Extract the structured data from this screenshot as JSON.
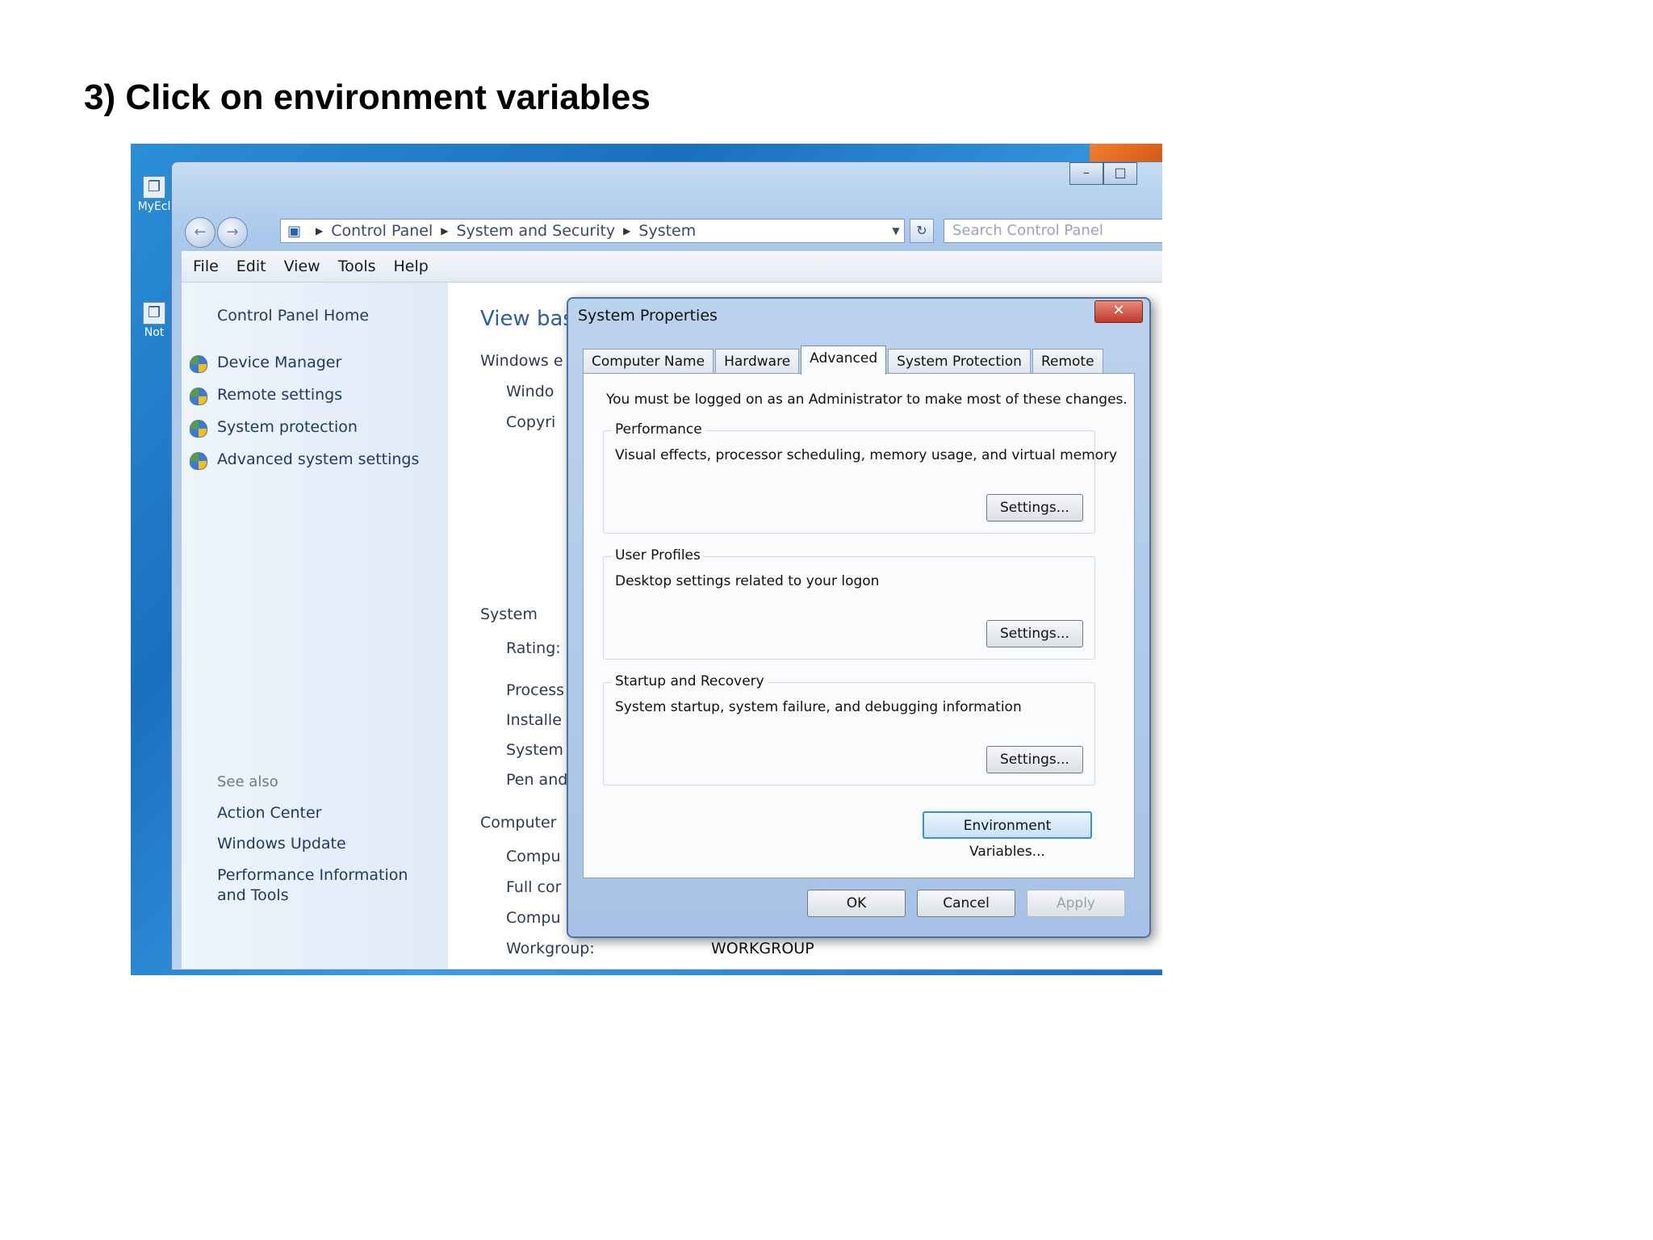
{
  "heading": "3) Click on environment variables",
  "desktop": {
    "icons": [
      {
        "label": "MyEcl",
        "glyph": "❐"
      },
      {
        "label": "Not",
        "glyph": "❐"
      }
    ]
  },
  "explorer": {
    "title_buttons": {
      "minimize": "–",
      "maximize": "□"
    },
    "nav": {
      "back": "←",
      "forward": "→"
    },
    "breadcrumb": [
      "Control Panel",
      "System and Security",
      "System"
    ],
    "refresh_glyph": "↻",
    "search_placeholder": "Search Control Panel",
    "menu": [
      "File",
      "Edit",
      "View",
      "Tools",
      "Help"
    ],
    "left_pane": {
      "home": "Control Panel Home",
      "tasks": [
        "Device Manager",
        "Remote settings",
        "System protection",
        "Advanced system settings"
      ],
      "see_also_label": "See also",
      "see_also": [
        "Action Center",
        "Windows Update",
        "Performance Information and Tools"
      ]
    },
    "main_pane": {
      "title": "View bas",
      "windows_edition": "Windows e",
      "edition_lines": [
        "Windo",
        "Copyri"
      ],
      "system": "System",
      "system_lines": [
        "Rating:",
        "Process",
        "Installe",
        "System",
        "Pen and"
      ],
      "computer": "Computer",
      "computer_lines": [
        "Compu",
        "Full cor",
        "Compu"
      ],
      "workgroup_label": "Workgroup:",
      "workgroup_value": "WORKGROUP"
    }
  },
  "dialog": {
    "title": "System Properties",
    "close_glyph": "✕",
    "tabs": [
      "Computer Name",
      "Hardware",
      "Advanced",
      "System Protection",
      "Remote"
    ],
    "active_tab": "Advanced",
    "admin_note": "You must be logged on as an Administrator to make most of these changes.",
    "groups": [
      {
        "legend": "Performance",
        "desc": "Visual effects, processor scheduling, memory usage, and virtual memory",
        "button": "Settings..."
      },
      {
        "legend": "User Profiles",
        "desc": "Desktop settings related to your logon",
        "button": "Settings..."
      },
      {
        "legend": "Startup and Recovery",
        "desc": "System startup, system failure, and debugging information",
        "button": "Settings..."
      }
    ],
    "env_button": "Environment Variables...",
    "ok": "OK",
    "cancel": "Cancel",
    "apply": "Apply"
  }
}
